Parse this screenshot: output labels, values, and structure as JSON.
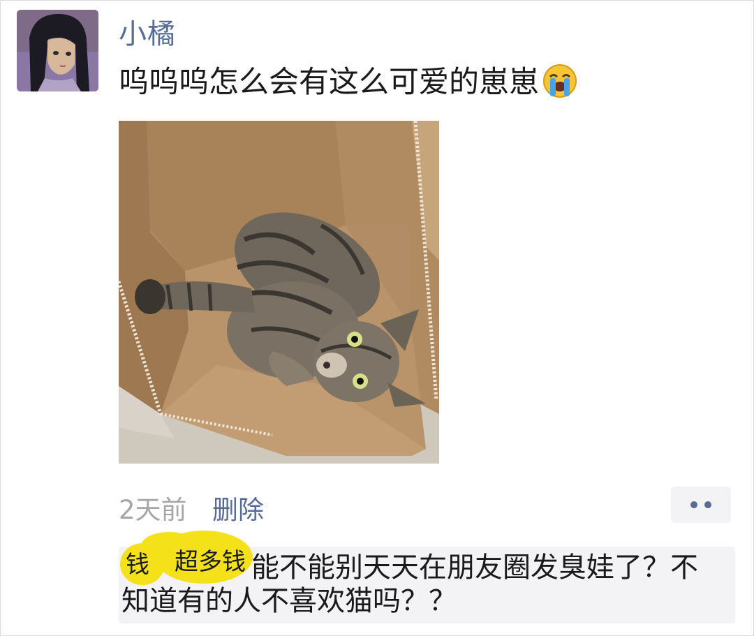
{
  "post": {
    "nickname": "小橘",
    "text": "呜呜呜怎么会有这么可爱的崽崽",
    "emoji": "crying-face-icon",
    "image": "photo of tabby cat lying in cardboard box"
  },
  "meta": {
    "time": "2天前",
    "delete_label": "删除",
    "more_icon": "two-dots-icon"
  },
  "comment": {
    "text": "能不能别天天在朋友圈发臭娃了？不知道有的人不喜欢猫吗？？",
    "sticker_text": [
      "钱",
      "超多钱"
    ]
  },
  "colors": {
    "link": "#576b95",
    "time": "#a6a6a6",
    "comment_bg": "#f3f3f5",
    "sticker": "#f5e11a"
  }
}
